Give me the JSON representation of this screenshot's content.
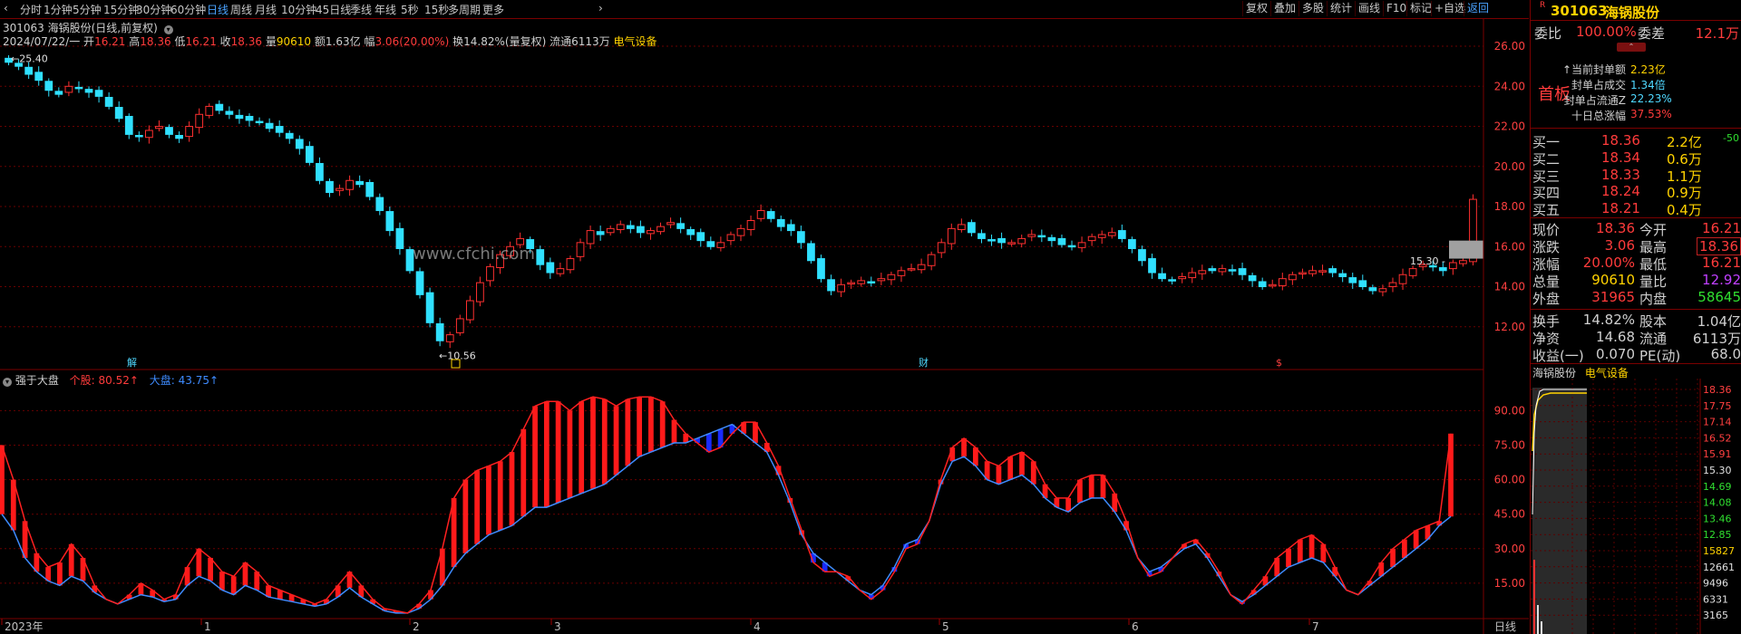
{
  "toolbar": {
    "timeframes": [
      "分时",
      "1分钟",
      "5分钟",
      "15分钟",
      "30分钟",
      "60分钟",
      "日线",
      "周线",
      "月线",
      "10分钟",
      "45日线",
      "季线",
      "年线",
      "5秒",
      "15秒",
      "多周期",
      "更多"
    ],
    "active_timeframe": "日线",
    "tools": [
      "复权",
      "叠加",
      "多股",
      "统计",
      "画线",
      "F10",
      "标记",
      "+自选",
      "返回"
    ]
  },
  "header": {
    "stock_line": "301063 海锅股份(日线,前复权)",
    "date": "2024/07/22/一",
    "open_label": "开",
    "open": "16.21",
    "high_label": "高",
    "high": "18.36",
    "low_label": "低",
    "low": "16.21",
    "close_label": "收",
    "close": "18.36",
    "volume_label": "量",
    "volume": "90610",
    "amount_label": "额",
    "amount": "1.63亿",
    "change_label": "幅",
    "change": "3.06(20.00%)",
    "turnover": "换14.82%(量复权)",
    "float": "流通6113万",
    "sector": "电气设备"
  },
  "price_chart": {
    "y_ticks": [
      "26.00",
      "24.00",
      "22.00",
      "20.00",
      "18.00",
      "16.00",
      "14.00",
      "12.00"
    ],
    "max_label": "25.40",
    "min_label": "10.56",
    "current_label": "15.30",
    "markers": [
      "解",
      "财",
      "$"
    ],
    "watermark": "www.cfchi.com"
  },
  "indicator": {
    "name": "强于大盘",
    "stock_label": "个股: 80.52↑",
    "market_label": "大盘: 43.75↑",
    "y_ticks": [
      "90.00",
      "75.00",
      "60.00",
      "45.00",
      "30.00",
      "15.00"
    ]
  },
  "x_axis": {
    "labels": [
      "2023年",
      "1",
      "2",
      "3",
      "4",
      "5",
      "6",
      "7"
    ],
    "period": "日线"
  },
  "chart_data": [
    {
      "type": "candlestick",
      "title": "301063 海锅股份(日线,前复权)",
      "ylim": [
        10.0,
        26.5
      ],
      "y_ticks": [
        26,
        24,
        22,
        20,
        18,
        16,
        14,
        12
      ],
      "x_labels": [
        "2023年",
        "1",
        "2",
        "3",
        "4",
        "5",
        "6",
        "7"
      ],
      "close": [
        25.2,
        25.0,
        24.6,
        24.3,
        23.8,
        23.6,
        24.0,
        23.9,
        23.7,
        23.5,
        23.0,
        22.4,
        21.6,
        21.5,
        21.8,
        22.0,
        21.6,
        21.4,
        22.0,
        22.6,
        23.0,
        22.8,
        22.6,
        22.4,
        22.3,
        22.2,
        21.9,
        21.7,
        21.4,
        20.9,
        20.2,
        19.3,
        18.7,
        18.9,
        19.3,
        19.1,
        18.5,
        17.8,
        16.8,
        15.9,
        14.8,
        13.6,
        12.2,
        11.3,
        11.6,
        12.4,
        13.3,
        14.2,
        15.0,
        15.6,
        16.0,
        16.4,
        15.9,
        15.1,
        14.7,
        14.9,
        15.4,
        16.2,
        16.8,
        16.6,
        16.9,
        17.1,
        16.9,
        16.7,
        16.8,
        17.0,
        17.2,
        16.9,
        16.6,
        16.3,
        16.0,
        16.2,
        16.6,
        16.9,
        17.3,
        17.8,
        17.4,
        17.0,
        16.8,
        16.2,
        15.3,
        14.4,
        13.8,
        14.1,
        14.2,
        14.3,
        14.2,
        14.4,
        14.6,
        14.8,
        14.9,
        15.1,
        15.6,
        16.2,
        16.9,
        17.1,
        16.7,
        16.4,
        16.3,
        16.2,
        16.2,
        16.4,
        16.6,
        16.5,
        16.3,
        16.1,
        16.0,
        16.2,
        16.5,
        16.6,
        16.7,
        16.4,
        15.9,
        15.3,
        14.7,
        14.4,
        14.3,
        14.5,
        14.7,
        14.8,
        14.8,
        14.9,
        14.8,
        14.6,
        14.3,
        14.0,
        14.1,
        14.4,
        14.6,
        14.7,
        14.8,
        14.8,
        14.7,
        14.5,
        14.2,
        14.0,
        13.8,
        13.9,
        14.2,
        14.6,
        14.9,
        15.1,
        15.0,
        14.8,
        15.2,
        15.3,
        18.36
      ],
      "max_label": 25.4,
      "min_label": 10.56,
      "last_price": 18.36,
      "ref_price": 15.3
    },
    {
      "type": "line",
      "title": "强于大盘",
      "ylim": [
        0,
        100
      ],
      "y_ticks": [
        90,
        75,
        60,
        45,
        30,
        15
      ],
      "series": [
        {
          "name": "个股",
          "color": "#ff2020",
          "values": [
            75,
            60,
            42,
            28,
            22,
            24,
            32,
            26,
            14,
            8,
            6,
            10,
            15,
            12,
            8,
            10,
            22,
            30,
            26,
            20,
            18,
            24,
            20,
            14,
            12,
            10,
            8,
            6,
            8,
            14,
            20,
            14,
            8,
            4,
            3,
            2,
            6,
            12,
            30,
            52,
            60,
            64,
            66,
            68,
            72,
            82,
            92,
            94,
            94,
            90,
            94,
            96,
            95,
            92,
            95,
            96,
            96,
            94,
            86,
            80,
            76,
            72,
            74,
            80,
            85,
            85,
            76,
            66,
            52,
            38,
            24,
            20,
            20,
            18,
            12,
            8,
            12,
            20,
            30,
            32,
            42,
            60,
            74,
            78,
            74,
            68,
            66,
            70,
            72,
            68,
            58,
            52,
            52,
            60,
            62,
            62,
            54,
            42,
            26,
            18,
            20,
            26,
            32,
            34,
            28,
            20,
            10,
            6,
            12,
            18,
            26,
            30,
            34,
            36,
            32,
            22,
            12,
            10,
            16,
            24,
            30,
            34,
            38,
            40,
            42,
            80
          ]
        },
        {
          "name": "大盘",
          "color": "#3e8bff",
          "values": [
            45,
            38,
            26,
            20,
            16,
            14,
            18,
            16,
            11,
            8,
            6,
            8,
            10,
            9,
            7,
            8,
            14,
            18,
            16,
            12,
            10,
            14,
            12,
            9,
            8,
            7,
            6,
            5,
            6,
            9,
            13,
            9,
            6,
            3,
            2,
            2,
            4,
            8,
            14,
            22,
            28,
            32,
            36,
            38,
            40,
            44,
            48,
            48,
            50,
            52,
            54,
            56,
            58,
            62,
            66,
            70,
            72,
            74,
            76,
            76,
            78,
            80,
            82,
            84,
            80,
            76,
            72,
            62,
            50,
            36,
            28,
            24,
            20,
            16,
            12,
            10,
            14,
            22,
            32,
            34,
            42,
            58,
            68,
            70,
            66,
            60,
            58,
            60,
            62,
            58,
            52,
            48,
            46,
            50,
            52,
            52,
            46,
            38,
            26,
            20,
            22,
            26,
            30,
            32,
            26,
            18,
            10,
            7,
            10,
            14,
            18,
            22,
            24,
            26,
            24,
            18,
            12,
            10,
            14,
            18,
            22,
            26,
            30,
            34,
            40,
            44
          ]
        }
      ],
      "last_values": {
        "个股": 80.52,
        "大盘": 43.75
      }
    },
    {
      "type": "line",
      "title": "海锅股份 电气设备",
      "ylim": [
        3165,
        18.36
      ],
      "y_ticks": [
        "18.36",
        "17.75",
        "17.14",
        "16.52",
        "15.91",
        "15.30",
        "14.69",
        "14.08",
        "13.46",
        "12.85",
        "15827",
        "12661",
        "9496",
        "6331",
        "3165"
      ],
      "x_labels": []
    }
  ],
  "right_panel": {
    "code": "301063",
    "name": "海锅股份",
    "wei_bi_label": "委比",
    "wei_bi": "100.00%",
    "wei_cha_label": "委差",
    "wei_cha": "12.1万",
    "first_board": "首板",
    "seal_lines": [
      {
        "label": "当前封单额",
        "value": "2.23亿",
        "color": "#ffd200"
      },
      {
        "label": "封单占成交",
        "value": "1.34倍",
        "color": "#4fd8ff"
      },
      {
        "label": "封单占流通Z",
        "value": "22.23%",
        "color": "#4fd8ff"
      },
      {
        "label": "十日总涨幅",
        "value": "37.53%",
        "color": "#ff3b3b"
      }
    ],
    "bids": [
      {
        "label": "买一",
        "price": "18.36",
        "vol": "2.2亿",
        "delta": "-50"
      },
      {
        "label": "买二",
        "price": "18.34",
        "vol": "0.6万",
        "delta": ""
      },
      {
        "label": "买三",
        "price": "18.33",
        "vol": "1.1万",
        "delta": ""
      },
      {
        "label": "买四",
        "price": "18.24",
        "vol": "0.9万",
        "delta": ""
      },
      {
        "label": "买五",
        "price": "18.21",
        "vol": "0.4万",
        "delta": ""
      }
    ],
    "quote": [
      {
        "l1": "现价",
        "v1": "18.36",
        "c1": "#ff3b3b",
        "l2": "今开",
        "v2": "16.21",
        "c2": "#ff3b3b",
        "box": false
      },
      {
        "l1": "涨跌",
        "v1": "3.06",
        "c1": "#ff3b3b",
        "l2": "最高",
        "v2": "18.36",
        "c2": "#ff3b3b",
        "box": true
      },
      {
        "l1": "涨幅",
        "v1": "20.00%",
        "c1": "#ff3b3b",
        "l2": "最低",
        "v2": "16.21",
        "c2": "#ff3b3b",
        "box": false
      },
      {
        "l1": "总量",
        "v1": "90610",
        "c1": "#ffd200",
        "l2": "量比",
        "v2": "12.92",
        "c2": "#c040ff",
        "box": false
      },
      {
        "l1": "外盘",
        "v1": "31965",
        "c1": "#ff3b3b",
        "l2": "内盘",
        "v2": "58645",
        "c2": "#30e030",
        "box": false
      }
    ],
    "stats": [
      {
        "l1": "换手",
        "v1": "14.82%",
        "l2": "股本",
        "v2": "1.04亿"
      },
      {
        "l1": "净资",
        "v1": "14.68",
        "l2": "流通",
        "v2": "6113万"
      },
      {
        "l1": "收益(一)",
        "v1": "0.070",
        "l2": "PE(动)",
        "v2": "68.0"
      }
    ],
    "mini_title": "海锅股份",
    "mini_sector": "电气设备"
  }
}
